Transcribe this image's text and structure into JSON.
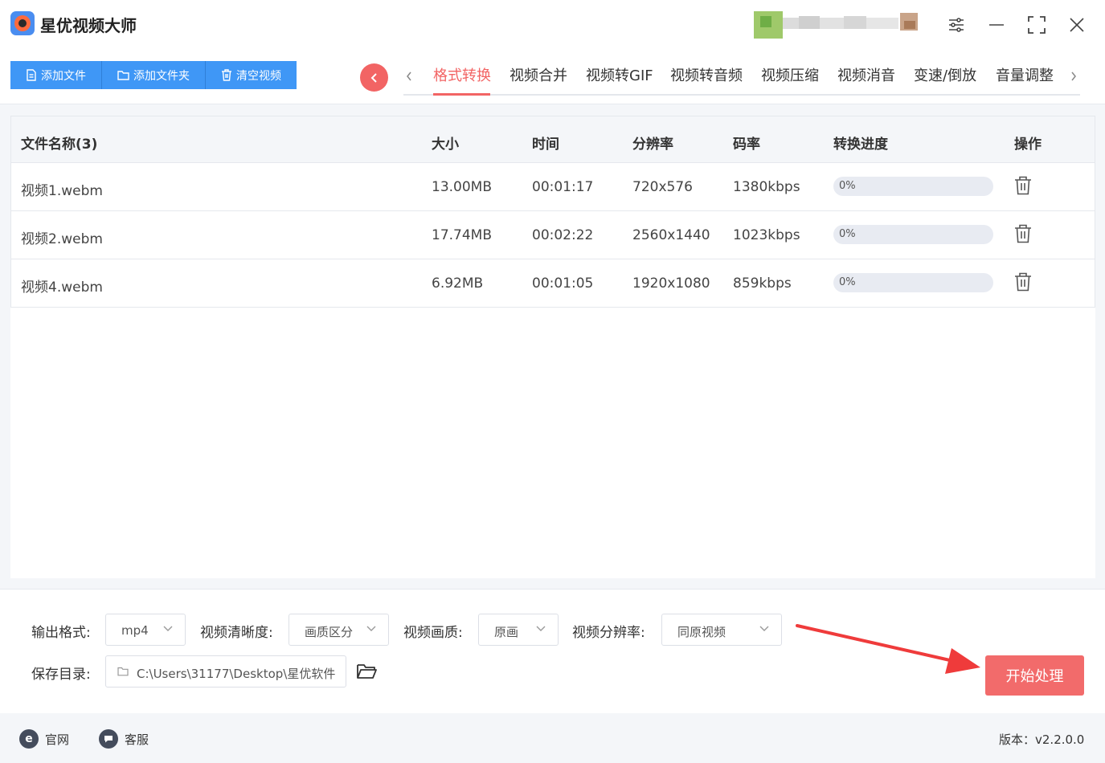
{
  "app": {
    "title": "星优视频大师"
  },
  "toolbar": {
    "add_file": "添加文件",
    "add_folder": "添加文件夹",
    "clear_video": "清空视频"
  },
  "tabs": [
    "格式转换",
    "视频合并",
    "视频转GIF",
    "视频转音频",
    "视频压缩",
    "视频消音",
    "变速/倒放",
    "音量调整"
  ],
  "table": {
    "headers": {
      "name": "文件名称(3)",
      "size": "大小",
      "time": "时间",
      "resolution": "分辨率",
      "bitrate": "码率",
      "progress": "转换进度",
      "action": "操作"
    },
    "rows": [
      {
        "name": "视频1.webm",
        "size": "13.00MB",
        "time": "00:01:17",
        "resolution": "720x576",
        "bitrate": "1380kbps",
        "progress": "0%",
        "progress_value": 0
      },
      {
        "name": "视频2.webm",
        "size": "17.74MB",
        "time": "00:02:22",
        "resolution": "2560x1440",
        "bitrate": "1023kbps",
        "progress": "0%",
        "progress_value": 0
      },
      {
        "name": "视频4.webm",
        "size": "6.92MB",
        "time": "00:01:05",
        "resolution": "1920x1080",
        "bitrate": "859kbps",
        "progress": "0%",
        "progress_value": 0
      }
    ]
  },
  "settings": {
    "output_format_label": "输出格式:",
    "output_format_value": "mp4",
    "clarity_label": "视频清晰度:",
    "clarity_value": "画质区分",
    "quality_label": "视频画质:",
    "quality_value": "原画",
    "resolution_label": "视频分辨率:",
    "resolution_value": "同原视频",
    "save_dir_label": "保存目录:",
    "save_dir_value": "C:\\Users\\31177\\Desktop\\星优软件",
    "start_button": "开始处理"
  },
  "footer": {
    "website": "官网",
    "support": "客服",
    "version": "版本：v2.2.0.0"
  },
  "colors": {
    "accent_red": "#f26464",
    "primary_blue": "#3f97f6",
    "start_button": "#f26b6b"
  }
}
